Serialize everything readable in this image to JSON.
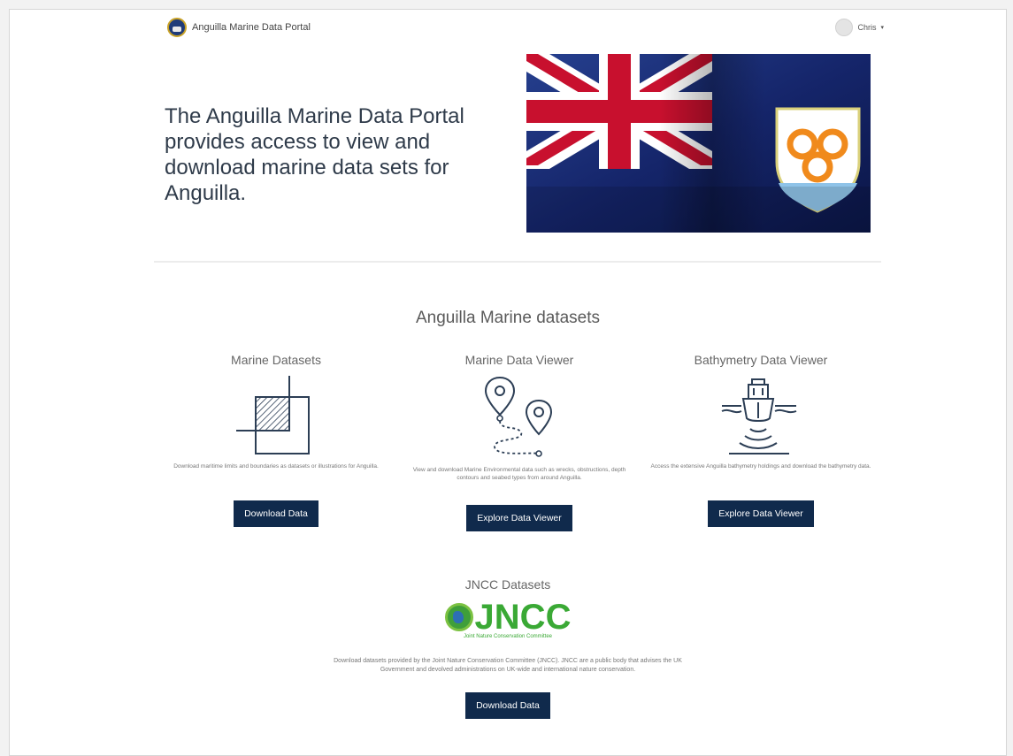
{
  "header": {
    "site_name": "Anguilla Marine Data Portal",
    "user_name": "Chris",
    "user_caret": "▾"
  },
  "hero": {
    "text": "The Anguilla Marine Data Portal provides access to view and download marine data sets for Anguilla."
  },
  "section": {
    "title": "Anguilla Marine datasets"
  },
  "cards": [
    {
      "title": "Marine Datasets",
      "icon": "boundary-grid-icon",
      "description": "Download maritime limits and boundaries as datasets or illustrations for Anguilla.",
      "button": "Download Data"
    },
    {
      "title": "Marine Data Viewer",
      "icon": "map-pins-route-icon",
      "description": "View and download Marine Environmental data such as wrecks, obstructions, depth contours and seabed types from around Anguilla.",
      "button": "Explore Data Viewer"
    },
    {
      "title": "Bathymetry Data Viewer",
      "icon": "ship-sonar-icon",
      "description": "Access the extensive Anguilla bathymetry holdings and download the bathymetry data.",
      "button": "Explore Data Viewer"
    }
  ],
  "jncc": {
    "title": "JNCC Datasets",
    "logo_text": "JNCC",
    "logo_subtitle": "Joint Nature Conservation Committee",
    "description": "Download datasets provided by the Joint Nature Conservation Committee (JNCC). JNCC are a public body that advises the UK Government and devolved administrations on UK-wide and international nature conservation.",
    "button": "Download Data"
  },
  "colors": {
    "button_bg": "#102a4c",
    "jncc_green": "#3aa935",
    "flag_blue": "#1a2f7a"
  }
}
